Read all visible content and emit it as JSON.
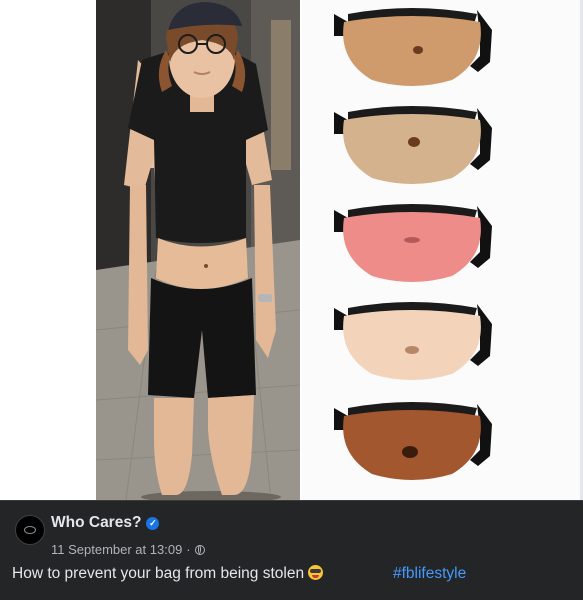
{
  "post": {
    "author": "Who Cares?",
    "timestamp": "11 September at 13:09",
    "separator": "·",
    "audience_icon": "globe-icon",
    "caption": "How to prevent your bag from being stolen",
    "caption_emoji": "laughing-face-emoji",
    "hashtag": "#fblifestyle",
    "verified_badge": "verified-check-icon"
  },
  "media": {
    "left_photo": "person-with-crop-top",
    "right_photo": "belly-shaped-fanny-packs",
    "bag_skin_tones": [
      "#cf9a6c",
      "#d4b28d",
      "#ee8c8a",
      "#f3d3ba",
      "#a2572e"
    ]
  },
  "colors": {
    "footer_bg": "#242526",
    "text_primary": "#e4e6eb",
    "text_secondary": "#b0b3b8",
    "link": "#4599ff",
    "verified": "#1b74e4"
  }
}
